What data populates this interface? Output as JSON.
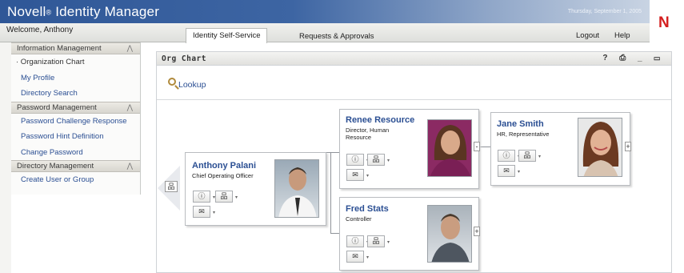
{
  "header": {
    "brand": "Novell",
    "reg": "®",
    "product": "Identity Manager",
    "date": "Thursday, September 1, 2005",
    "logo_letter": "N",
    "welcome": "Welcome, Anthony",
    "tabs": [
      "Identity Self-Service",
      "Requests & Approvals"
    ],
    "links": {
      "logout": "Logout",
      "help": "Help"
    }
  },
  "sidebar": {
    "sections": [
      {
        "title": "Information Management",
        "items": [
          "· Organization Chart",
          "My Profile",
          "Directory Search"
        ]
      },
      {
        "title": "Password Management",
        "items": [
          "Password Challenge Response",
          "Password Hint Definition",
          "Change Password"
        ]
      },
      {
        "title": "Directory Management",
        "items": [
          "Create User or Group"
        ]
      }
    ],
    "chevron": "⋀"
  },
  "portlet": {
    "title": "Org Chart",
    "controls": "? ⎙ _ ▭",
    "lookup": "Lookup"
  },
  "people": [
    {
      "name": "Anthony Palani",
      "title": "Chief Operating Officer"
    },
    {
      "name": "Renee Resource",
      "title": "Director, Human Resource"
    },
    {
      "name": "Fred Stats",
      "title": "Controller"
    },
    {
      "name": "Jane Smith",
      "title": "HR, Representative"
    }
  ],
  "buttons": {
    "info": "ⓘ",
    "org": "品",
    "email": "✉"
  },
  "expanders": {
    "minus": "-",
    "plus": "+"
  },
  "colors": {
    "accent": "#2f5797",
    "link": "#2b4f93",
    "brand_red": "#d41f1f"
  }
}
